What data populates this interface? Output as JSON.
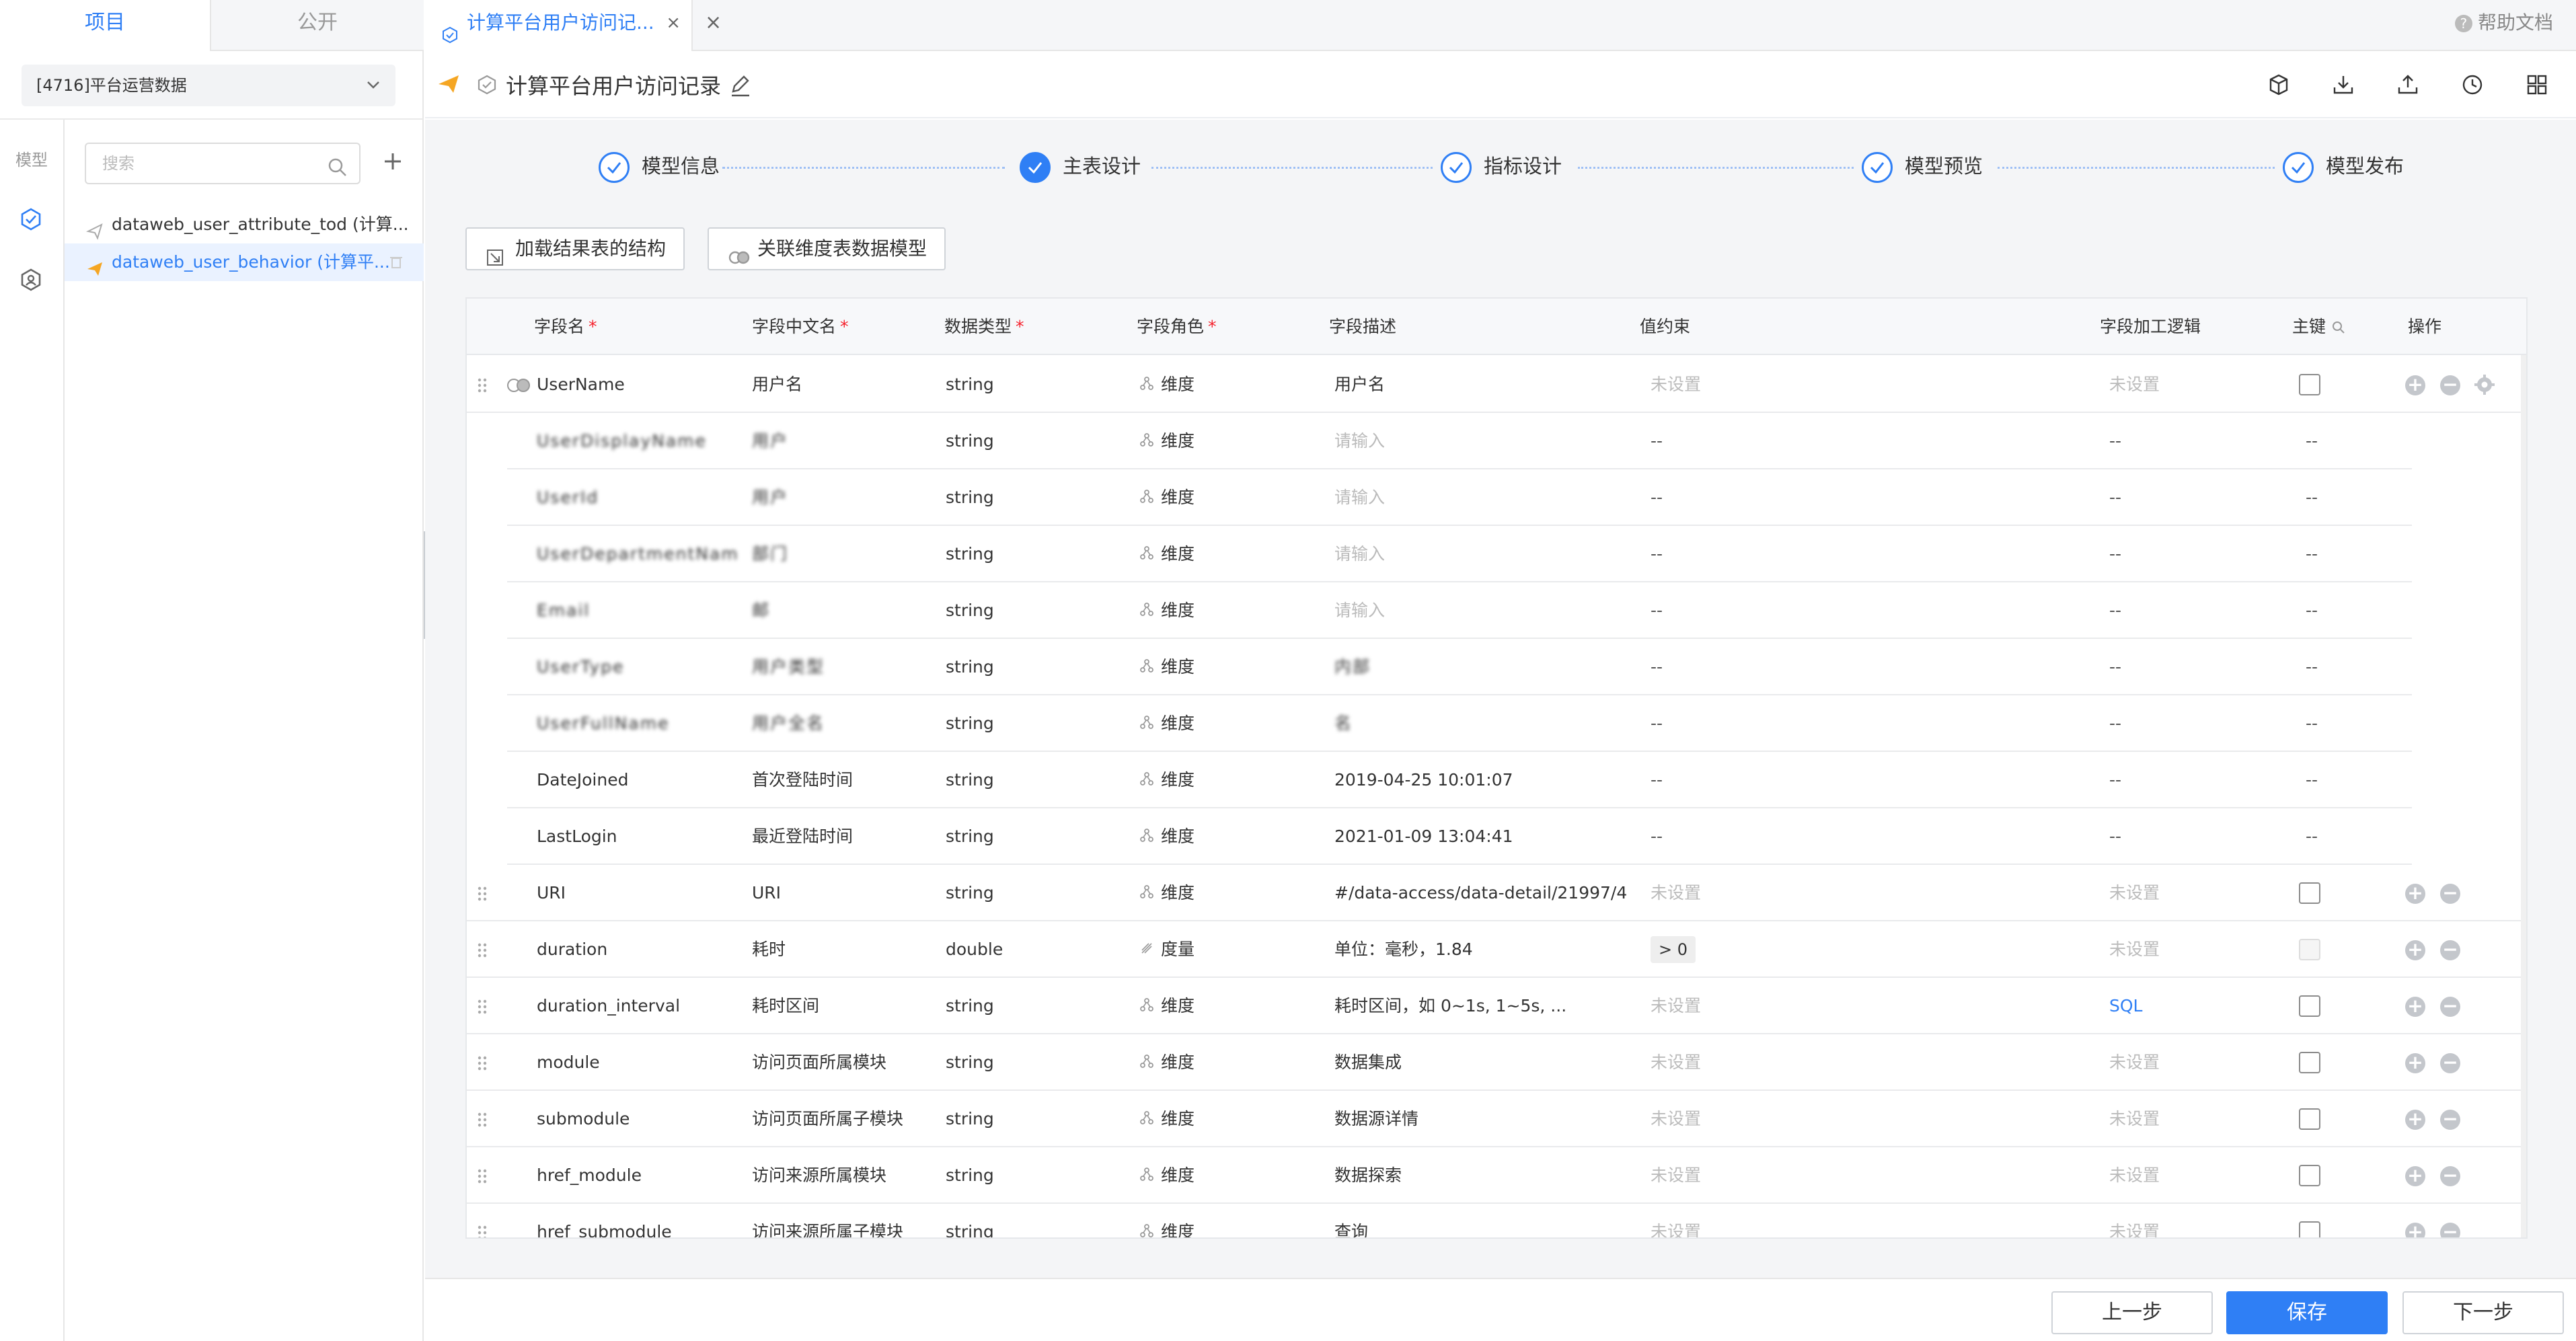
{
  "sidebar": {
    "tabs": [
      "项目",
      "公开"
    ],
    "project_select": "[4716]平台运营数据",
    "rail_label": "模型",
    "search_placeholder": "搜索",
    "tree": [
      {
        "label": "dataweb_user_attribute_tod (计算...",
        "icon": "model-icon"
      },
      {
        "label": "dataweb_user_behavior (计算平...",
        "icon": "plane-icon",
        "selected": true
      }
    ]
  },
  "topbar": {
    "tab_title": "计算平台用户访问记...",
    "close": "×",
    "help": "帮助文档"
  },
  "title": {
    "text": "计算平台用户访问记录"
  },
  "steps": [
    "模型信息",
    "主表设计",
    "指标设计",
    "模型预览",
    "模型发布"
  ],
  "actions": {
    "load_structure": "加载结果表的结构",
    "link_dimension": "关联维度表数据模型"
  },
  "table": {
    "headers": [
      "字段名",
      "字段中文名",
      "数据类型",
      "字段角色",
      "字段描述",
      "值约束",
      "字段加工逻辑",
      "主键",
      "操作"
    ],
    "required_mark": "*",
    "rows": [
      {
        "name": "UserName",
        "cn": "用户名",
        "type": "string",
        "role": "维度",
        "desc": "用户名",
        "constraint": "未设置",
        "logic": "未设置",
        "pk": "",
        "kind": "main"
      },
      {
        "name": "UserDisplayName",
        "cn": "用户",
        "type": "string",
        "role": "维度",
        "desc": "请输入",
        "constraint": "--",
        "logic": "--",
        "pk": "--",
        "kind": "sub-blur"
      },
      {
        "name": "UserId",
        "cn": "用户",
        "type": "string",
        "role": "维度",
        "desc": "请输入",
        "constraint": "--",
        "logic": "--",
        "pk": "--",
        "kind": "sub-blur"
      },
      {
        "name": "UserDepartmentName",
        "cn": "部门",
        "type": "string",
        "role": "维度",
        "desc": "请输入",
        "constraint": "--",
        "logic": "--",
        "pk": "--",
        "kind": "sub-blur"
      },
      {
        "name": "Email",
        "cn": "邮",
        "type": "string",
        "role": "维度",
        "desc": "请输入",
        "constraint": "--",
        "logic": "--",
        "pk": "--",
        "kind": "sub-blur"
      },
      {
        "name": "UserType",
        "cn": "用户类型",
        "type": "string",
        "role": "维度",
        "desc": "内部",
        "constraint": "--",
        "logic": "--",
        "pk": "--",
        "kind": "sub-blur-desc"
      },
      {
        "name": "UserFullName",
        "cn": "用户全名",
        "type": "string",
        "role": "维度",
        "desc": "名",
        "constraint": "--",
        "logic": "--",
        "pk": "--",
        "kind": "sub-blur-desc"
      },
      {
        "name": "DateJoined",
        "cn": "首次登陆时间",
        "type": "string",
        "role": "维度",
        "desc": "2019-04-25 10:01:07",
        "constraint": "--",
        "logic": "--",
        "pk": "--",
        "kind": "sub"
      },
      {
        "name": "LastLogin",
        "cn": "最近登陆时间",
        "type": "string",
        "role": "维度",
        "desc": "2021-01-09 13:04:41",
        "constraint": "--",
        "logic": "--",
        "pk": "--",
        "kind": "sub"
      },
      {
        "name": "URI",
        "cn": "URI",
        "type": "string",
        "role": "维度",
        "desc": "#/data-access/data-detail/21997/4",
        "constraint": "未设置",
        "logic": "未设置",
        "pk": "",
        "kind": "main"
      },
      {
        "name": "duration",
        "cn": "耗时",
        "type": "double",
        "role": "度量",
        "desc": "单位：毫秒，1.84",
        "constraint": "> 0",
        "logic": "未设置",
        "pk": "",
        "kind": "main-measure"
      },
      {
        "name": "duration_interval",
        "cn": "耗时区间",
        "type": "string",
        "role": "维度",
        "desc": "耗时区间，如 0~1s, 1~5s, ...",
        "constraint": "未设置",
        "logic": "SQL",
        "pk": "",
        "kind": "main-sql"
      },
      {
        "name": "module",
        "cn": "访问页面所属模块",
        "type": "string",
        "role": "维度",
        "desc": "数据集成",
        "constraint": "未设置",
        "logic": "未设置",
        "pk": "",
        "kind": "main"
      },
      {
        "name": "submodule",
        "cn": "访问页面所属子模块",
        "type": "string",
        "role": "维度",
        "desc": "数据源详情",
        "constraint": "未设置",
        "logic": "未设置",
        "pk": "",
        "kind": "main"
      },
      {
        "name": "href_module",
        "cn": "访问来源所属模块",
        "type": "string",
        "role": "维度",
        "desc": "数据探索",
        "constraint": "未设置",
        "logic": "未设置",
        "pk": "",
        "kind": "main"
      },
      {
        "name": "href_submodule",
        "cn": "访问来源所属子模块",
        "type": "string",
        "role": "维度",
        "desc": "查询",
        "constraint": "未设置",
        "logic": "未设置",
        "pk": "",
        "kind": "main"
      }
    ]
  },
  "footer": {
    "prev": "上一步",
    "save": "保存",
    "next": "下一步"
  },
  "colors": {
    "primary": "#2f7ff5",
    "required": "#f5222d",
    "muted": "#bbbbbb"
  }
}
